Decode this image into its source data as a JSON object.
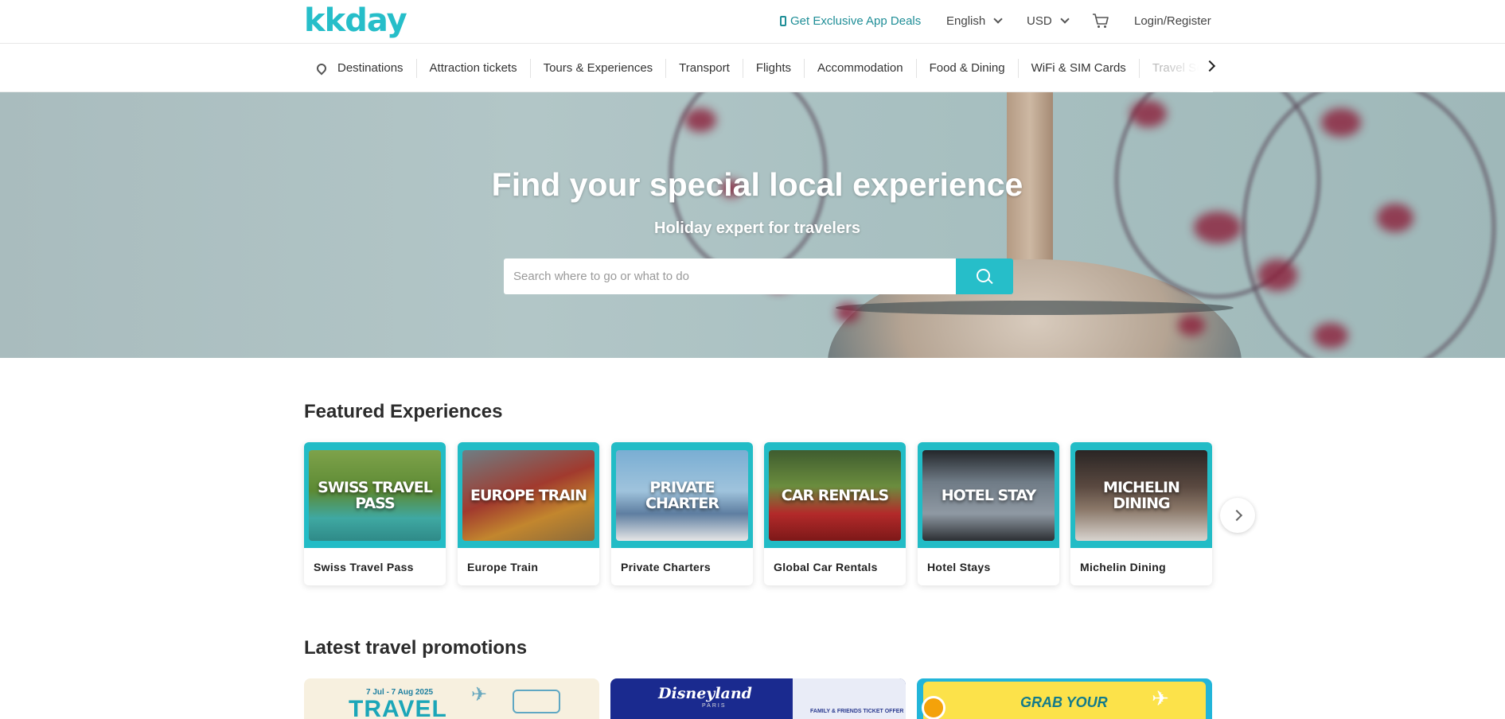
{
  "header": {
    "logo": "kkday",
    "app_deals": "Get Exclusive App Deals",
    "language": "English",
    "currency": "USD",
    "login": "Login/Register"
  },
  "nav": {
    "items": [
      "Destinations",
      "Attraction tickets",
      "Tours & Experiences",
      "Transport",
      "Flights",
      "Accommodation",
      "Food & Dining",
      "WiFi & SIM Cards",
      "Travel Se"
    ]
  },
  "hero": {
    "title": "Find your special local experience",
    "subtitle": "Holiday expert for travelers",
    "search_placeholder": "Search where to go or what to do"
  },
  "featured": {
    "title": "Featured Experiences",
    "cards": [
      {
        "overlay": "SWISS TRAVEL PASS",
        "label": "Swiss Travel Pass"
      },
      {
        "overlay": "EUROPE TRAIN",
        "label": "Europe Train"
      },
      {
        "overlay": "PRIVATE CHARTER",
        "label": "Private Charters"
      },
      {
        "overlay": "CAR RENTALS",
        "label": "Global Car Rentals"
      },
      {
        "overlay": "HOTEL STAY",
        "label": "Hotel Stays"
      },
      {
        "overlay": "MICHELIN DINING",
        "label": "Michelin Dining"
      }
    ]
  },
  "promotions": {
    "title": "Latest travel promotions",
    "banner1": {
      "date": "7 Jul - 7 Aug 2025",
      "headline": "TRAVEL"
    },
    "banner2": {
      "brand": "Disneyland",
      "sub": "PARIS",
      "offer": "FAMILY & FRIENDS TICKET OFFER"
    },
    "banner3": {
      "headline": "GRAB YOUR"
    }
  },
  "colors": {
    "brand": "#26bec9",
    "app_deals": "#1f8e97"
  }
}
